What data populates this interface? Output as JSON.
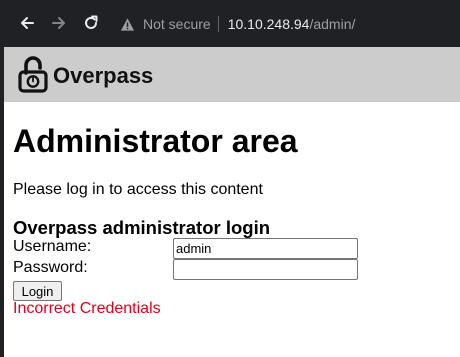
{
  "browser": {
    "back_icon": "arrow-left-icon",
    "forward_icon": "arrow-right-icon",
    "reload_icon": "reload-icon",
    "security_icon": "warning-triangle-icon",
    "security_label": "Not secure",
    "url_host": "10.10.248.94",
    "url_path": "/admin/"
  },
  "header": {
    "logo_icon": "unlocked-padlock-icon",
    "site_name": "Overpass",
    "background": "#cccccc"
  },
  "main": {
    "title": "Administrator area",
    "intro": "Please log in to access this content",
    "form": {
      "heading": "Overpass administrator login",
      "username_label": "Username:",
      "username_value": "admin",
      "password_label": "Password:",
      "password_value": "",
      "submit_label": "Login",
      "error_message": "Incorrect Credentials",
      "error_color": "#e6001c"
    }
  }
}
